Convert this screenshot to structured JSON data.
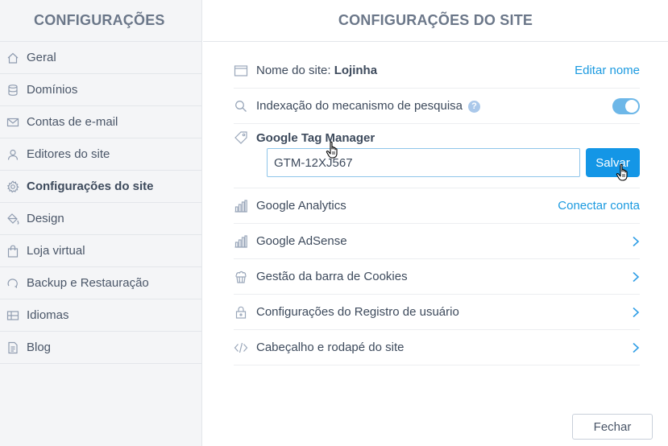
{
  "sidebar": {
    "title": "CONFIGURAÇÕES",
    "items": [
      {
        "label": "Geral",
        "icon": "home-icon"
      },
      {
        "label": "Domínios",
        "icon": "database-icon"
      },
      {
        "label": "Contas de e-mail",
        "icon": "mail-icon"
      },
      {
        "label": "Editores do site",
        "icon": "user-icon"
      },
      {
        "label": "Configurações do site",
        "icon": "gear-icon",
        "active": true
      },
      {
        "label": "Design",
        "icon": "paint-bucket-icon"
      },
      {
        "label": "Loja virtual",
        "icon": "shopping-bag-icon"
      },
      {
        "label": "Backup e Restauração",
        "icon": "backup-icon"
      },
      {
        "label": "Idiomas",
        "icon": "languages-icon"
      },
      {
        "label": "Blog",
        "icon": "document-icon"
      }
    ]
  },
  "main": {
    "title": "CONFIGURAÇÕES DO SITE",
    "site_name": {
      "label": "Nome do site:",
      "value": "Lojinha",
      "action": "Editar nome",
      "icon": "browser-window-icon"
    },
    "indexing": {
      "label": "Indexação do mecanismo de pesquisa",
      "help": "?",
      "enabled": true,
      "icon": "search-icon"
    },
    "gtm": {
      "label": "Google Tag Manager",
      "value": "GTM-12XJ567",
      "save_label": "Salvar",
      "icon": "tag-icon"
    },
    "analytics": {
      "label": "Google Analytics",
      "action": "Conectar conta",
      "icon": "bar-chart-icon"
    },
    "adsense": {
      "label": "Google AdSense",
      "icon": "bar-chart-icon"
    },
    "cookies": {
      "label": "Gestão da barra de Cookies",
      "icon": "cupcake-icon"
    },
    "registration": {
      "label": "Configurações do Registro de usuário",
      "icon": "lock-icon"
    },
    "header_footer": {
      "label": "Cabeçalho e rodapé do site",
      "icon": "code-icon"
    },
    "close_label": "Fechar"
  },
  "colors": {
    "accent": "#1496e6",
    "link": "#1b9ae0",
    "toggle": "#6db7e8"
  }
}
